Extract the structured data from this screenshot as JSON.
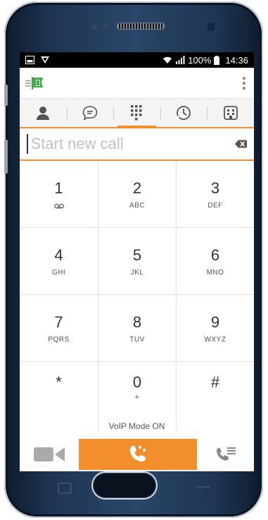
{
  "status_bar": {
    "battery": "100%",
    "time": "14:36"
  },
  "tabs": [
    {
      "id": "contacts",
      "icon": "person-icon"
    },
    {
      "id": "chat",
      "icon": "chat-bubble-icon"
    },
    {
      "id": "dialpad",
      "icon": "dialpad-icon",
      "active": true
    },
    {
      "id": "history",
      "icon": "clock-icon"
    },
    {
      "id": "directory",
      "icon": "building-icon"
    }
  ],
  "dial_input": {
    "placeholder": "Start new call",
    "value": ""
  },
  "keypad": [
    {
      "digit": "1",
      "letters": "",
      "sub_icon": "voicemail-icon"
    },
    {
      "digit": "2",
      "letters": "ABC"
    },
    {
      "digit": "3",
      "letters": "DEF"
    },
    {
      "digit": "4",
      "letters": "GHI"
    },
    {
      "digit": "5",
      "letters": "JKL"
    },
    {
      "digit": "6",
      "letters": "MNO"
    },
    {
      "digit": "7",
      "letters": "PQRS"
    },
    {
      "digit": "8",
      "letters": "TUV"
    },
    {
      "digit": "9",
      "letters": "WXYZ"
    },
    {
      "digit": "*",
      "letters": ""
    },
    {
      "digit": "0",
      "letters": "+"
    },
    {
      "digit": "#",
      "letters": ""
    }
  ],
  "voip_status": "VoIP Mode ON",
  "colors": {
    "accent": "#f28e2b",
    "brand_green": "#3fae49"
  }
}
